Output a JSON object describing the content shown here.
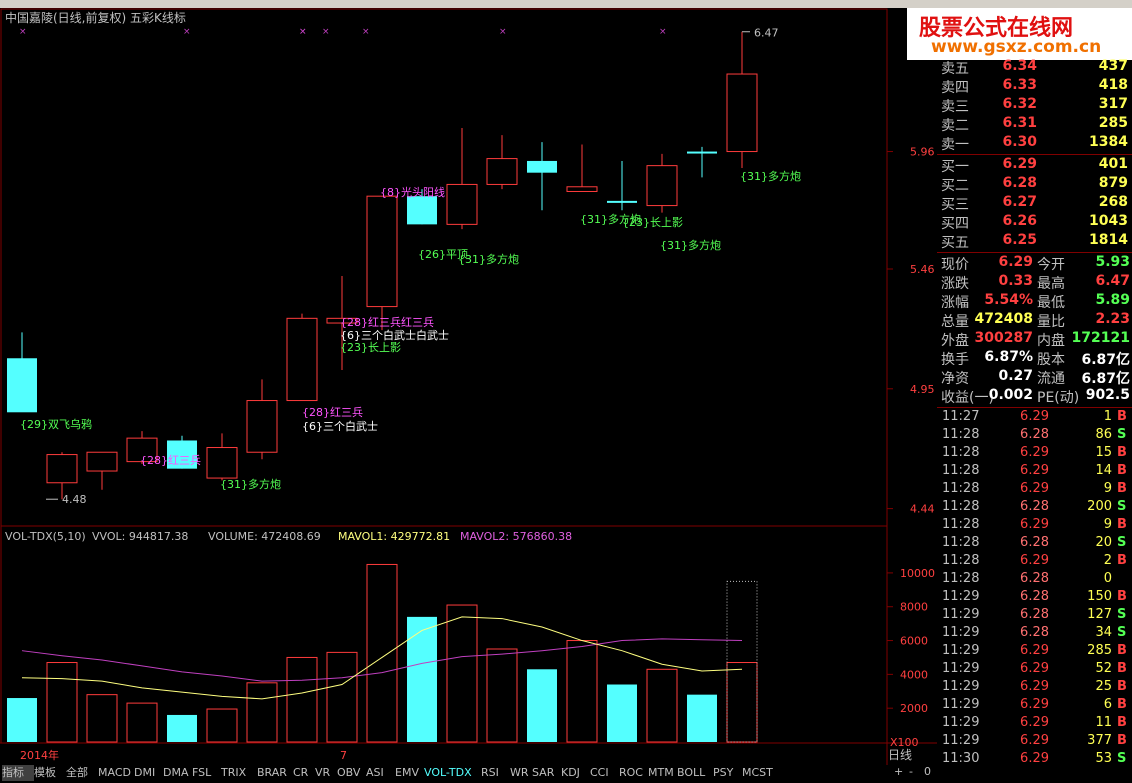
{
  "window": {
    "chart_title": "中国嘉陵(日线,前复权) 五彩K线标",
    "right_label": "日线",
    "x100_label": "X100",
    "year_label": "2014年",
    "month_label": "7"
  },
  "watermark": {
    "line1": "股票公式在线网",
    "line2": "www.gsxz.com.cn"
  },
  "price_axis": [
    "5.96",
    "5.46",
    "4.95",
    "4.44"
  ],
  "volume_axis": [
    "10000",
    "8000",
    "6000",
    "4000",
    "2000"
  ],
  "volume_header": {
    "name": "VOL-TDX(5,10)",
    "vvol": "VVOL: 944817.38",
    "volume": "VOLUME: 472408.69",
    "mavol1": "MAVOL1: 429772.81",
    "mavol2": "MAVOL2: 576860.38"
  },
  "labels": {
    "high_mark": "6.47",
    "low_mark": "4.48",
    "annotations": [
      {
        "text": "{29}双飞乌鸦",
        "color": "#54ff54"
      },
      {
        "text": "{28}红三兵",
        "color": "#ff54ff"
      },
      {
        "text": "{31}多方炮",
        "color": "#54ff54"
      },
      {
        "text": "{28}红三兵",
        "color": "#ff54ff"
      },
      {
        "text": "{6}三个白武士",
        "color": "#ffffff"
      },
      {
        "text": "{28}红三兵红三兵",
        "color": "#ff54ff"
      },
      {
        "text": "{6}三个白武士白武士",
        "color": "#ffffff"
      },
      {
        "text": "{23}长上影",
        "color": "#54ff54"
      },
      {
        "text": "{8}光头阳线",
        "color": "#ff54ff"
      },
      {
        "text": "{26}平顶",
        "color": "#54ff54"
      },
      {
        "text": "{31}多方炮",
        "color": "#54ff54"
      },
      {
        "text": "{31}多方炮",
        "color": "#54ff54"
      },
      {
        "text": "{23}长上影",
        "color": "#54ff54"
      },
      {
        "text": "{31}多方炮",
        "color": "#54ff54"
      },
      {
        "text": "{31}多方炮",
        "color": "#54ff54"
      }
    ]
  },
  "quote": {
    "asks": [
      {
        "label": "卖五",
        "price": "6.34",
        "vol": "437"
      },
      {
        "label": "卖四",
        "price": "6.33",
        "vol": "418"
      },
      {
        "label": "卖三",
        "price": "6.32",
        "vol": "317"
      },
      {
        "label": "卖二",
        "price": "6.31",
        "vol": "285"
      },
      {
        "label": "卖一",
        "price": "6.30",
        "vol": "1384"
      }
    ],
    "bids": [
      {
        "label": "买一",
        "price": "6.29",
        "vol": "401"
      },
      {
        "label": "买二",
        "price": "6.28",
        "vol": "879"
      },
      {
        "label": "买三",
        "price": "6.27",
        "vol": "268"
      },
      {
        "label": "买四",
        "price": "6.26",
        "vol": "1043"
      },
      {
        "label": "买五",
        "price": "6.25",
        "vol": "1814"
      }
    ]
  },
  "stats": [
    {
      "l1": "现价",
      "v1": "6.29",
      "c1": "#ff4040",
      "l2": "今开",
      "v2": "5.93",
      "c2": "#54ff54"
    },
    {
      "l1": "涨跌",
      "v1": "0.33",
      "c1": "#ff4040",
      "l2": "最高",
      "v2": "6.47",
      "c2": "#ff4040"
    },
    {
      "l1": "涨幅",
      "v1": "5.54%",
      "c1": "#ff4040",
      "l2": "最低",
      "v2": "5.89",
      "c2": "#54ff54"
    },
    {
      "l1": "总量",
      "v1": "472408",
      "c1": "#ffff54",
      "l2": "量比",
      "v2": "2.23",
      "c2": "#ff4040"
    },
    {
      "l1": "外盘",
      "v1": "300287",
      "c1": "#ff4040",
      "l2": "内盘",
      "v2": "172121",
      "c2": "#54ff54"
    },
    {
      "l1": "换手",
      "v1": "6.87%",
      "c1": "#ffffff",
      "l2": "股本",
      "v2": "6.87亿",
      "c2": "#ffffff"
    },
    {
      "l1": "净资",
      "v1": "0.27",
      "c1": "#ffffff",
      "l2": "流通",
      "v2": "6.87亿",
      "c2": "#ffffff"
    },
    {
      "l1": "收益(一)",
      "v1": "0.002",
      "c1": "#ffffff",
      "l2": "PE(动)",
      "v2": "902.5",
      "c2": "#ffffff"
    }
  ],
  "ticks": [
    {
      "time": "11:27",
      "price": "6.29",
      "vol": "1",
      "side": "B"
    },
    {
      "time": "11:28",
      "price": "6.28",
      "vol": "86",
      "side": "S"
    },
    {
      "time": "11:28",
      "price": "6.29",
      "vol": "15",
      "side": "B"
    },
    {
      "time": "11:28",
      "price": "6.29",
      "vol": "14",
      "side": "B"
    },
    {
      "time": "11:28",
      "price": "6.29",
      "vol": "9",
      "side": "B"
    },
    {
      "time": "11:28",
      "price": "6.28",
      "vol": "200",
      "side": "S"
    },
    {
      "time": "11:28",
      "price": "6.29",
      "vol": "9",
      "side": "B"
    },
    {
      "time": "11:28",
      "price": "6.28",
      "vol": "20",
      "side": "S"
    },
    {
      "time": "11:28",
      "price": "6.29",
      "vol": "2",
      "side": "B"
    },
    {
      "time": "11:28",
      "price": "6.28",
      "vol": "0",
      "side": ""
    },
    {
      "time": "11:29",
      "price": "6.28",
      "vol": "150",
      "side": "B"
    },
    {
      "time": "11:29",
      "price": "6.28",
      "vol": "127",
      "side": "S"
    },
    {
      "time": "11:29",
      "price": "6.28",
      "vol": "34",
      "side": "S"
    },
    {
      "time": "11:29",
      "price": "6.29",
      "vol": "285",
      "side": "B"
    },
    {
      "time": "11:29",
      "price": "6.29",
      "vol": "52",
      "side": "B"
    },
    {
      "time": "11:29",
      "price": "6.29",
      "vol": "25",
      "side": "B"
    },
    {
      "time": "11:29",
      "price": "6.29",
      "vol": "6",
      "side": "B"
    },
    {
      "time": "11:29",
      "price": "6.29",
      "vol": "11",
      "side": "B"
    },
    {
      "time": "11:29",
      "price": "6.29",
      "vol": "377",
      "side": "B"
    },
    {
      "time": "11:30",
      "price": "6.29",
      "vol": "53",
      "side": "S"
    }
  ],
  "bottom_tabs": [
    "指标",
    "模板",
    "全部",
    "MACD",
    "DMI",
    "DMA",
    "FSL",
    "TRIX",
    "BRAR",
    "CR",
    "VR",
    "OBV",
    "ASI",
    "EMV",
    "VOL-TDX",
    "RSI",
    "WR",
    "SAR",
    "KDJ",
    "CCI",
    "ROC",
    "MTM",
    "BOLL",
    "PSY",
    "MCST"
  ],
  "colors": {
    "up": "#ff3c3c",
    "down": "#54ffff",
    "ma1": "#ffff80",
    "ma2": "#c040c0"
  },
  "chart_data": {
    "type": "candlestick",
    "price_ticks": [
      5.96,
      5.46,
      4.95,
      4.44
    ],
    "candles": [
      {
        "o": 5.08,
        "h": 5.19,
        "l": 4.9,
        "c": 4.85,
        "dir": "down"
      },
      {
        "o": 4.55,
        "h": 4.68,
        "l": 4.48,
        "c": 4.67,
        "dir": "up"
      },
      {
        "o": 4.6,
        "h": 4.68,
        "l": 4.52,
        "c": 4.68,
        "dir": "up"
      },
      {
        "o": 4.64,
        "h": 4.77,
        "l": 4.63,
        "c": 4.74,
        "dir": "up"
      },
      {
        "o": 4.73,
        "h": 4.75,
        "l": 4.61,
        "c": 4.61,
        "dir": "down"
      },
      {
        "o": 4.57,
        "h": 4.76,
        "l": 4.56,
        "c": 4.7,
        "dir": "up"
      },
      {
        "o": 4.68,
        "h": 4.99,
        "l": 4.65,
        "c": 4.9,
        "dir": "up"
      },
      {
        "o": 4.9,
        "h": 5.27,
        "l": 4.9,
        "c": 5.25,
        "dir": "up"
      },
      {
        "o": 5.23,
        "h": 5.43,
        "l": 5.03,
        "c": 5.25,
        "dir": "up"
      },
      {
        "o": 5.3,
        "h": 5.75,
        "l": 5.2,
        "c": 5.77,
        "dir": "up"
      },
      {
        "o": 5.77,
        "h": 5.8,
        "l": 5.65,
        "c": 5.65,
        "dir": "down"
      },
      {
        "o": 5.65,
        "h": 6.06,
        "l": 5.63,
        "c": 5.82,
        "dir": "up"
      },
      {
        "o": 5.82,
        "h": 6.03,
        "l": 5.8,
        "c": 5.93,
        "dir": "up"
      },
      {
        "o": 5.92,
        "h": 6.0,
        "l": 5.71,
        "c": 5.87,
        "dir": "down"
      },
      {
        "o": 5.79,
        "h": 5.99,
        "l": 5.79,
        "c": 5.81,
        "dir": "up"
      },
      {
        "o": 5.75,
        "h": 5.92,
        "l": 5.71,
        "c": 5.75,
        "dir": "down"
      },
      {
        "o": 5.73,
        "h": 5.95,
        "l": 5.7,
        "c": 5.9,
        "dir": "up"
      },
      {
        "o": 5.96,
        "h": 5.98,
        "l": 5.85,
        "c": 5.96,
        "dir": "down"
      },
      {
        "o": 5.96,
        "h": 6.47,
        "l": 5.89,
        "c": 6.29,
        "dir": "up"
      }
    ],
    "volume_ticks": [
      10000,
      8000,
      6000,
      4000,
      2000
    ],
    "volumes": [
      2600,
      4700,
      2800,
      2300,
      1600,
      1950,
      3500,
      5000,
      5300,
      10500,
      7400,
      8100,
      5500,
      4300,
      6000,
      3400,
      4300,
      2800,
      4700
    ],
    "vol_dir": [
      "down",
      "up",
      "up",
      "up",
      "down",
      "up",
      "up",
      "up",
      "up",
      "up",
      "down",
      "up",
      "up",
      "down",
      "up",
      "down",
      "up",
      "down",
      "up"
    ],
    "mavol1": [
      3800,
      3750,
      3600,
      3200,
      2950,
      2700,
      2550,
      2900,
      3400,
      5000,
      6600,
      7400,
      7300,
      6800,
      6000,
      5400,
      4600,
      4200,
      4300
    ],
    "mavol2": [
      5400,
      5100,
      4850,
      4500,
      4150,
      3900,
      3600,
      3650,
      3800,
      4100,
      4650,
      5050,
      5200,
      5400,
      5650,
      6000,
      6100,
      6050,
      6000
    ],
    "forecast_volume": 9500
  }
}
